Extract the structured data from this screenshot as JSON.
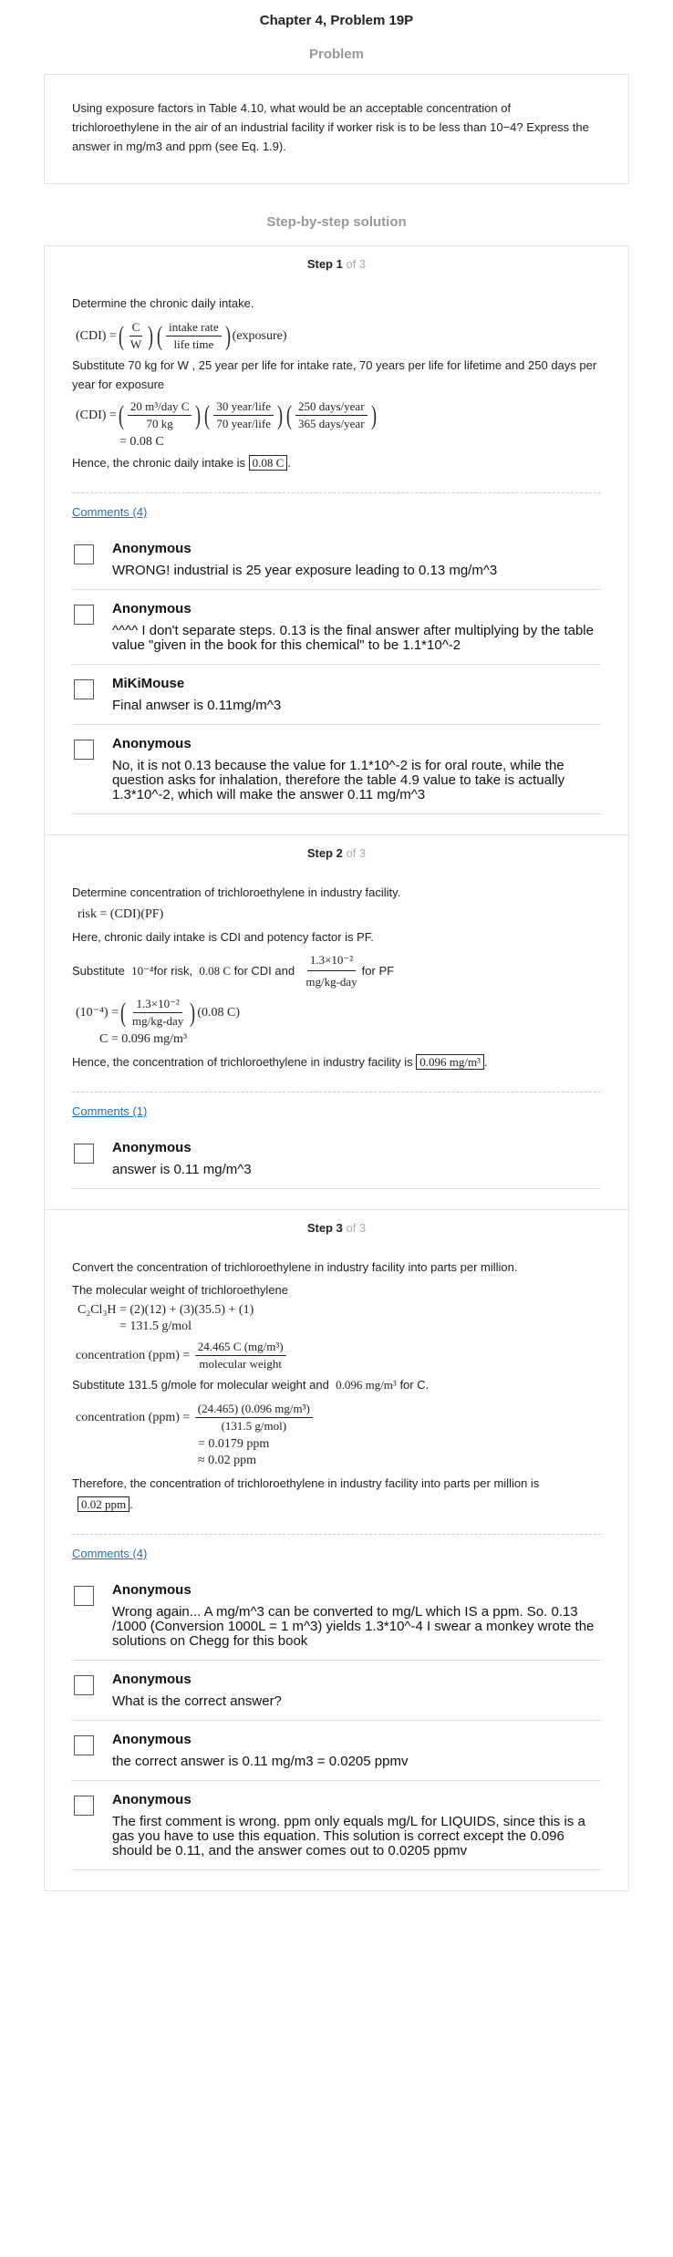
{
  "header": {
    "title": "Chapter 4, Problem 19P"
  },
  "problem": {
    "heading": "Problem",
    "text": "Using exposure factors in Table 4.10, what would be an acceptable concentration of trichloroethylene in the air of an industrial facility if worker risk is to be less than 10−4? Express the answer in mg/m3 and ppm (see Eq. 1.9)."
  },
  "solution": {
    "heading": "Step-by-step solution",
    "steps": [
      {
        "label": "Step 1",
        "of": "of 3",
        "intro": "Determine the chronic daily intake.",
        "substitute": "Substitute 70 kg for W , 25 year per life for intake rate, 70 years per life for lifetime and 250 days per year for exposure",
        "result_text": "Hence, the chronic daily intake is",
        "result_value": "0.08 C",
        "eq1": {
          "lhs": "(CDI) =",
          "c": "C",
          "w": "W",
          "num": "intake rate",
          "den": "life time",
          "tail": "(exposure)"
        },
        "eq2": {
          "lhs": "(CDI) =",
          "n1": "20 m³/day C",
          "d1": "70 kg",
          "n2": "30 year/life",
          "d2": "70 year/life",
          "n3": "250 days/year",
          "d3": "365 days/year",
          "res": "= 0.08 C"
        },
        "comments_link": "Comments (4)",
        "comments": [
          {
            "name": "Anonymous",
            "text": "WRONG! industrial is 25 year exposure leading to 0.13 mg/m^3"
          },
          {
            "name": "Anonymous",
            "text": "^^^^ I don't separate steps. 0.13 is the final answer after multiplying by the table value \"given in the book for this chemical\" to be 1.1*10^-2"
          },
          {
            "name": "MiKiMouse",
            "text": "Final anwser is 0.11mg/m^3"
          },
          {
            "name": "Anonymous",
            "text": "No, it is not 0.13 because the value for 1.1*10^-2 is for oral route, while the question asks for inhalation, therefore the table 4.9 value to take is actually 1.3*10^-2, which will make the answer 0.11 mg/m^3"
          }
        ]
      },
      {
        "label": "Step 2",
        "of": "of 3",
        "intro": "Determine concentration of trichloroethylene in industry facility.",
        "eq1": "risk = (CDI)(PF)",
        "here": "Here, chronic daily intake is CDI and potency factor is PF.",
        "sub_a": "Substitute",
        "sub_b": "10⁻⁴",
        "sub_c": "for risk,",
        "sub_d": "0.08 C",
        "sub_e": "for CDI and",
        "sub_fn": "1.3×10⁻²",
        "sub_fd": "mg/kg-day",
        "sub_g": "for PF",
        "eq2": {
          "lhs": "(10⁻⁴) =",
          "num": "1.3×10⁻²",
          "den": "mg/kg-day",
          "tail": "(0.08 C)",
          "res": "C = 0.096 mg/m³"
        },
        "result_text": "Hence, the concentration of trichloroethylene in industry facility is",
        "result_value": "0.096 mg/m³",
        "comments_link": "Comments (1)",
        "comments": [
          {
            "name": "Anonymous",
            "text": "answer is 0.11 mg/m^3"
          }
        ]
      },
      {
        "label": "Step 3",
        "of": "of 3",
        "intro": "Convert the concentration of trichloroethylene in industry facility into parts per million.",
        "mw_text": "The molecular weight of trichloroethylene",
        "mw_eq": "C₂Cl₃H = (2)(12) + (3)(35.5) + (1)",
        "mw_res": "= 131.5 g/mol",
        "conc_lhs": "concentration (ppm) =",
        "conc_num": "24.465 C (mg/m³)",
        "conc_den": "molecular weight",
        "sub_a": "Substitute 131.5 g/mole for molecular weight and",
        "sub_b": "0.096 mg/m³",
        "sub_c": "for C.",
        "eq3_num": "(24.465)  (0.096 mg/m³)",
        "eq3_den": "(131.5 g/mol)",
        "eq3_r1": "= 0.0179 ppm",
        "eq3_r2": "≈ 0.02 ppm",
        "result_text": "Therefore, the concentration of trichloroethylene in industry facility into parts per million is",
        "result_value": "0.02 ppm",
        "comments_link": "Comments (4)",
        "comments": [
          {
            "name": "Anonymous",
            "text": "Wrong again... A mg/m^3 can be converted to mg/L which IS a ppm. So. 0.13 /1000 (Conversion 1000L = 1 m^3) yields 1.3*10^-4 I swear a monkey wrote the solutions on Chegg for this book"
          },
          {
            "name": "Anonymous",
            "text": "What is the correct answer?"
          },
          {
            "name": "Anonymous",
            "text": "the correct answer is 0.11 mg/m3 = 0.0205 ppmv"
          },
          {
            "name": "Anonymous",
            "text": "The first comment is wrong. ppm only equals mg/L for LIQUIDS, since this is a gas you have to use this equation. This solution is correct except the 0.096 should be 0.11, and the answer comes out to 0.0205 ppmv"
          }
        ]
      }
    ]
  }
}
